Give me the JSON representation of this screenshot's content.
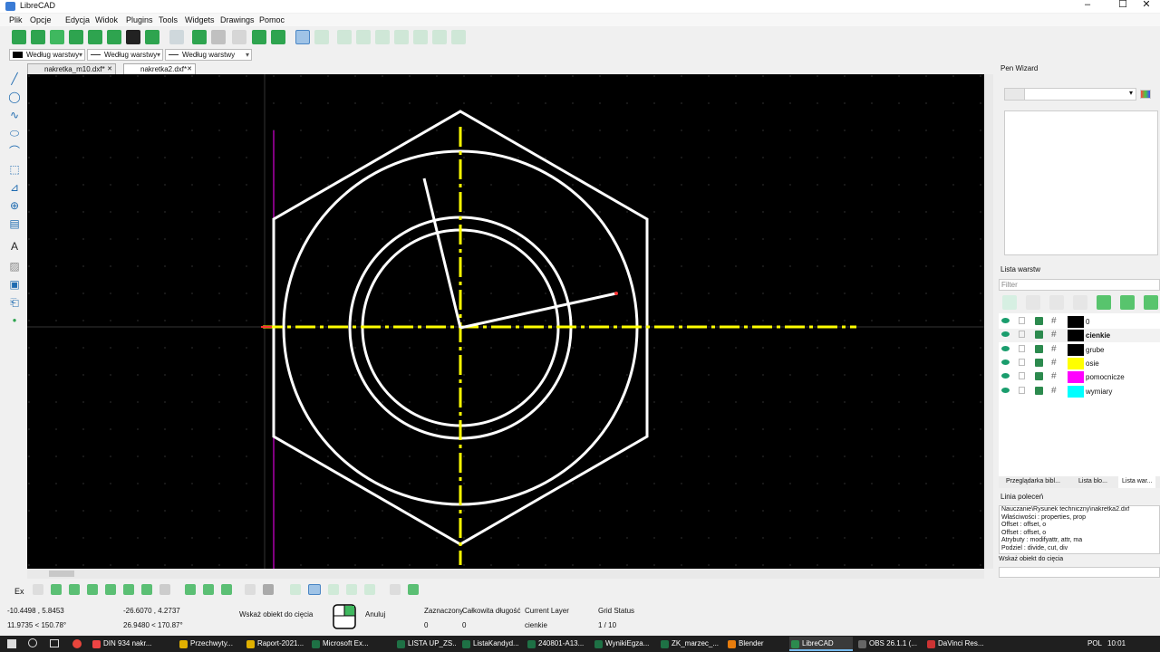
{
  "window": {
    "title": "LibreCAD"
  },
  "menu": [
    "Plik",
    "Opcje",
    "Edycja",
    "Widok",
    "Plugins",
    "Tools",
    "Widgets",
    "Drawings",
    "Pomoc"
  ],
  "pen": {
    "color_label": "Według warstwy",
    "type_label": "Według warstwy",
    "width_label": "Według warstwy"
  },
  "tabs": [
    {
      "label": "nakretka_m10.dxf*"
    },
    {
      "label": "nakretka2.dxf*"
    }
  ],
  "pen_wizard": {
    "title": "Pen Wizard"
  },
  "layers_panel": {
    "title": "Lista warstw",
    "filter_placeholder": "Filter",
    "layers": [
      {
        "name": "0",
        "color": "#000000",
        "bold": false
      },
      {
        "name": "cienkie",
        "color": "#000000",
        "bold": true
      },
      {
        "name": "grube",
        "color": "#000000",
        "bold": false
      },
      {
        "name": "osie",
        "color": "#ffff00",
        "bold": false
      },
      {
        "name": "pomocnicze",
        "color": "#ff00ff",
        "bold": false
      },
      {
        "name": "wymiary",
        "color": "#00ffff",
        "bold": false
      }
    ],
    "bottom_tabs": [
      "Przeglądarka bibl...",
      "Lista blo...",
      "Lista war..."
    ]
  },
  "command_line": {
    "title": "Linia poleceń",
    "lines": [
      "Nauczanie\\Rysunek techniczny\\nakretka2.dxf",
      "Właściwości : properties, prop",
      "Offset : offset, o",
      "Offset : offset, o",
      "Atrybuty : modifyattr, attr, ma",
      "Podziel : divide, cut, div"
    ],
    "prompt": "Wskaż obiekt do cięcia"
  },
  "status": {
    "snap_label": "Ex",
    "abs_coord": "-10.4498 , 5.8453",
    "abs_polar": "11.9735 < 150.78°",
    "rel_coord": "-26.6070 , 4.2737",
    "rel_polar": "26.9480 < 170.87°",
    "prompt": "Wskaż obiekt do cięcia",
    "cancel": "Anuluj",
    "selected_label": "Zaznaczony",
    "selected_value": "0",
    "total_length_label": "Całkowita długość",
    "total_length_value": "0",
    "current_layer_label": "Current Layer",
    "current_layer_value": "cienkie",
    "grid_status_label": "Grid Status",
    "grid_status_value": "1 / 10"
  },
  "taskbar": {
    "items": [
      {
        "label": "DIN 934 nakr...",
        "color": "#e44"
      },
      {
        "label": "Przechwyty...",
        "color": "#e0b000"
      },
      {
        "label": "Raport-2021...",
        "color": "#e0b000"
      },
      {
        "label": "Microsoft Ex...",
        "color": "#1e7145"
      },
      {
        "label": "LISTA UP_ZS...",
        "color": "#1e7145"
      },
      {
        "label": "ListaKandyd...",
        "color": "#1e7145"
      },
      {
        "label": "240801-A13...",
        "color": "#1e7145"
      },
      {
        "label": "WynikiEgza...",
        "color": "#1e7145"
      },
      {
        "label": "ZK_marzec_...",
        "color": "#1e7145"
      },
      {
        "label": "Blender",
        "color": "#e87d0d"
      },
      {
        "label": "LibreCAD",
        "color": "#2c8a4e"
      },
      {
        "label": "OBS 26.1.1 (...",
        "color": "#666"
      },
      {
        "label": "DaVinci Res...",
        "color": "#c33"
      }
    ],
    "lang": "POL",
    "clock": "10:01"
  },
  "colors": {
    "canvas": "#000000",
    "shape": "#ffffff",
    "axis": "#ffff00",
    "aux": "#ff00ff"
  }
}
